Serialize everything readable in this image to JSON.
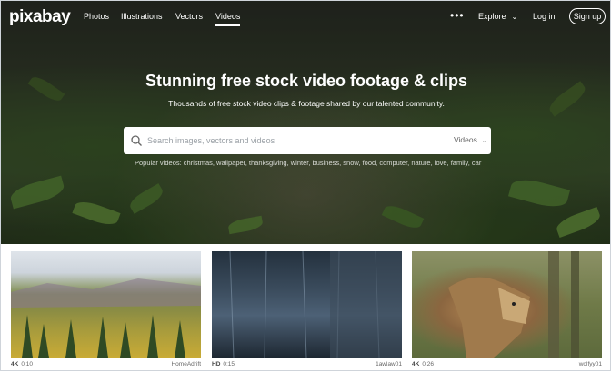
{
  "nav": {
    "logo": "pixabay",
    "links": [
      "Photos",
      "Illustrations",
      "Vectors",
      "Videos"
    ],
    "active_index": 3,
    "explore_label": "Explore",
    "login_label": "Log in",
    "signup_label": "Sign up"
  },
  "hero": {
    "title": "Stunning free stock video footage & clips",
    "subtitle": "Thousands of free stock video clips & footage shared by our talented community.",
    "search_placeholder": "Search images, vectors and videos",
    "search_type": "Videos",
    "popular_label": "Popular videos:",
    "popular_tags": "christmas, wallpaper, thanksgiving, winter, business, snow, food, computer, nature, love, family, car"
  },
  "videos": [
    {
      "quality": "4K",
      "duration": "0:10",
      "user": "HomeAdrift"
    },
    {
      "quality": "HD",
      "duration": "0:15",
      "user": "1awlaw01"
    },
    {
      "quality": "4K",
      "duration": "0:26",
      "user": "wolfyy01"
    }
  ],
  "colors": {
    "accent": "#ffffff",
    "search_bg": "#ffffff"
  }
}
